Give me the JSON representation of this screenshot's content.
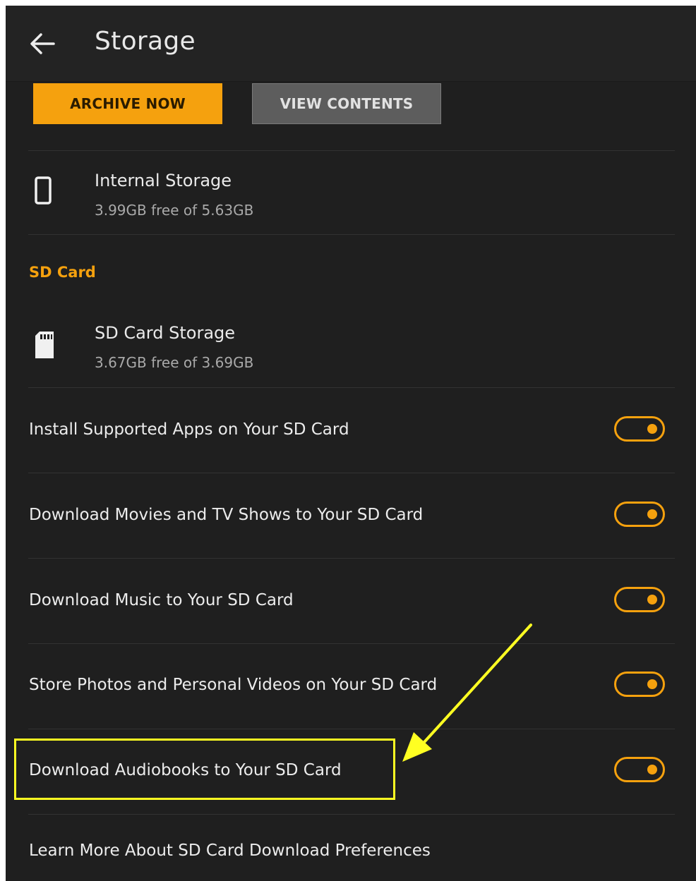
{
  "header": {
    "title": "Storage",
    "back_icon": "arrow-left-icon"
  },
  "actions": {
    "archive_label": "ARCHIVE NOW",
    "view_label": "VIEW CONTENTS"
  },
  "internal_storage": {
    "title": "Internal Storage",
    "subtitle": "3.99GB free of 5.63GB",
    "icon": "phone-icon"
  },
  "sd_section": {
    "header": "SD Card"
  },
  "sd_storage": {
    "title": "SD Card Storage",
    "subtitle": "3.67GB free of 3.69GB",
    "icon": "sd-card-icon"
  },
  "preferences": [
    {
      "label": "Install Supported Apps on Your SD Card",
      "enabled": true
    },
    {
      "label": "Download Movies and TV Shows to Your SD Card",
      "enabled": true
    },
    {
      "label": "Download Music to Your SD Card",
      "enabled": true
    },
    {
      "label": "Store Photos and Personal Videos on Your SD Card",
      "enabled": true
    },
    {
      "label": "Download Audiobooks to Your SD Card",
      "enabled": true
    }
  ],
  "learn_more": {
    "label": "Learn More About SD Card Download Preferences"
  },
  "colors": {
    "accent": "#f5a10e",
    "background": "#1f1f1f",
    "annotation": "#ffff22"
  }
}
